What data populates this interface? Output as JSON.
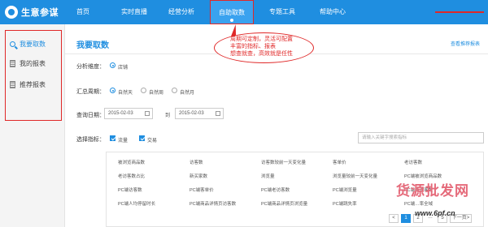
{
  "header": {
    "logo_text": "生意参谋",
    "nav": [
      {
        "label": "首页"
      },
      {
        "label": "实时直播"
      },
      {
        "label": "经营分析"
      },
      {
        "label": "自助取数"
      },
      {
        "label": "专题工具"
      },
      {
        "label": "帮助中心"
      }
    ],
    "active_index": 3
  },
  "sidebar": {
    "items": [
      {
        "label": "我要取数",
        "icon": "search-icon",
        "active": true
      },
      {
        "label": "我的报表",
        "icon": "report-icon",
        "active": false
      },
      {
        "label": "推荐报表",
        "icon": "report-icon",
        "active": false
      }
    ]
  },
  "main": {
    "title": "我要取数",
    "view_link": "查看推荐报表",
    "dimension": {
      "label": "分析维度：",
      "value": "店铺"
    },
    "period": {
      "label": "汇总周期：",
      "options": [
        "自然天",
        "自然周",
        "自然月"
      ],
      "selected": 0
    },
    "query_date": {
      "label": "查询日期：",
      "start": "2015-02-03",
      "to": "到",
      "end": "2015-02-03"
    },
    "indicators": {
      "label": "选择指标：",
      "checked": [
        "流量",
        "交易"
      ],
      "search_placeholder": "请输入关键字搜索指标"
    },
    "metrics": [
      [
        "被浏览商品数",
        "访客数",
        "访客数较前一天变化量",
        "客单价",
        "老访客数"
      ],
      [
        "老访客数占比",
        "新买家数",
        "浏览量",
        "浏览量较前一天变化量",
        "PC端被浏览商品数"
      ],
      [
        "PC端访客数",
        "PC端客单价",
        "PC端老访客数",
        "PC端浏览量",
        "PC端新访客数"
      ],
      [
        "PC端人均停留时长",
        "PC端商品详情页访客数",
        "PC端商品详情页浏览量",
        "PC端跳失率",
        "PC端…率全域"
      ]
    ],
    "pager": [
      "<",
      "1",
      "2",
      "…",
      "5",
      "下一页>"
    ]
  },
  "annotation": {
    "lines": [
      "周期可定制，灵活可配置",
      "丰富的指标、报表",
      "想查就查，高效就是任性"
    ]
  },
  "watermark": {
    "line1": "货源批发网",
    "line2": "www.6pf.cn"
  },
  "colors": {
    "primary": "#1f8ee0",
    "annotation_red": "#e02828"
  }
}
